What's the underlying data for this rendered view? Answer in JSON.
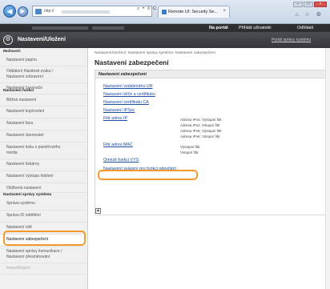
{
  "browser": {
    "address_prefix": "http://",
    "address_tools": "⌕ • ≡ C ×",
    "tab_title": "Remote UI: Security Se...",
    "tab_close": "×",
    "win_min": "–",
    "win_max": "□",
    "win_close": "×",
    "toolbar_icons": "⌂ ☆ ⚙"
  },
  "topbar": {
    "portal_label": "Na portál",
    "user_label": "Přihláš uživatelé:",
    "logout_label": "Odhlásit"
  },
  "header": {
    "title": "Nastavení/Uložení",
    "portal_link": "Portál správy systému"
  },
  "sidebar": {
    "items": [
      {
        "label": "Možnosti:",
        "kind": "category"
      },
      {
        "label": "Nastavení papíru",
        "kind": "item"
      },
      {
        "label": "Oddálení hlasitosti zvuku /",
        "label2": "Nastavení zobrazení",
        "kind": "item"
      },
      {
        "label": "Nastavení časovače",
        "kind": "item"
      },
      {
        "label": "Nastavení funkcí",
        "kind": "category"
      },
      {
        "label": "Běžná nastavení",
        "kind": "item"
      },
      {
        "label": "Nastavení kopírování",
        "kind": "item"
      },
      {
        "label": "Nastavení faxu",
        "kind": "item"
      },
      {
        "label": "Nastavení skenování",
        "kind": "item"
      },
      {
        "label": "Nastavení tisku z paměťového",
        "label2": "média",
        "kind": "item"
      },
      {
        "label": "Nastavení tiskárny",
        "kind": "item"
      },
      {
        "label": "Nastavení výstupu hlášení",
        "kind": "item"
      },
      {
        "label": "Oblíbená nastavení",
        "kind": "item"
      },
      {
        "label": "Nastavení správy systému",
        "kind": "category"
      },
      {
        "label": "Správa systému",
        "kind": "item"
      },
      {
        "label": "Správa ID oddělení",
        "kind": "item"
      },
      {
        "label": "Nastavení sítě",
        "kind": "item"
      },
      {
        "label": "Nastavení zabezpečení",
        "kind": "item"
      },
      {
        "label": "Nastavení správy komunikace /",
        "label2": "Nastavení přesměrování",
        "kind": "item"
      },
      {
        "label": "Import/Export",
        "kind": "item"
      }
    ]
  },
  "main": {
    "breadcrumb": "Nastavení/Uložení: Nastavení správy systému: Nastavení zabezpečení",
    "title": "Nastavení zabezpečení",
    "section_title": "Nastavení zabezpečení",
    "links": [
      "Nastavení vzdáleného UR",
      "Nastavení klíče a certifikátu",
      "Nastavení certifikátu CA",
      "Nastavení IPSec",
      "Filtr adres IP",
      "Filtr adres MAC",
      "Omezit funkci VYS",
      "Nastavení svázení pro funkci odesílání"
    ],
    "ip_filter_status": [
      "Adresa IPv4: Výstupní filtr",
      "Adresa IPv4: Vstupní filtr",
      "Adresa IPv6: Výstupní filtr",
      "Adresa IPv6: Vstupní filtr"
    ],
    "mac_filter_status": [
      "Výstupní filtr",
      "Vstupní filtr"
    ],
    "top_icon": "▲"
  },
  "colors": {
    "highlight": "#f39a2b",
    "link": "#1f4ea3",
    "header_bg": "#3a3c40"
  }
}
